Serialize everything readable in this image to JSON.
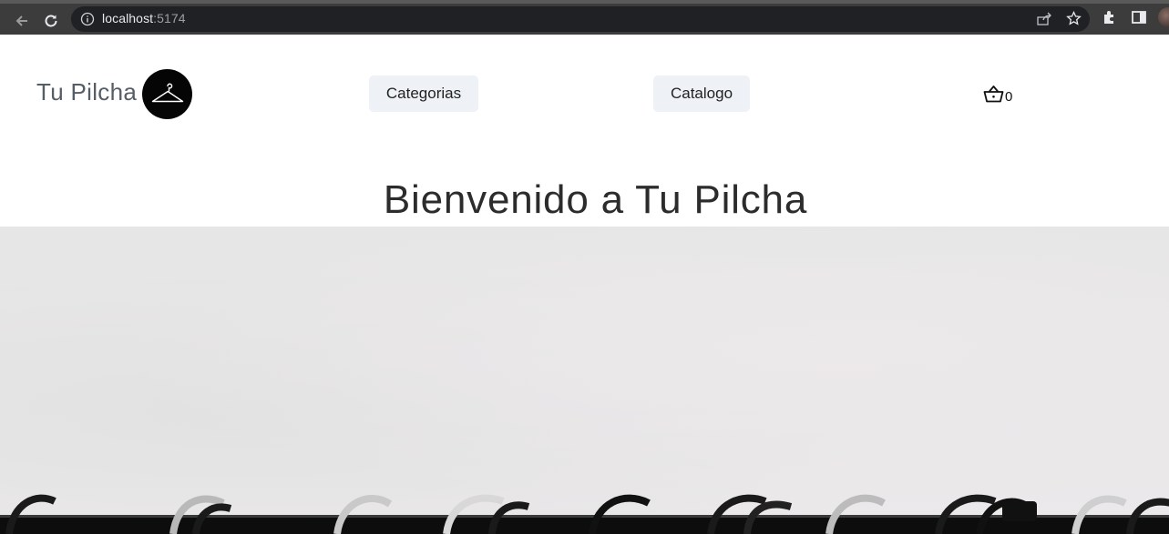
{
  "browser": {
    "url_host": "localhost",
    "url_port": ":5174",
    "icons": [
      "back-arrow-icon",
      "reload-icon",
      "info-icon",
      "share-icon",
      "star-icon",
      "extensions-icon",
      "sidepanel-icon",
      "profile-avatar"
    ]
  },
  "header": {
    "brand": "Tu Pilcha",
    "logo_icon": "hanger-icon",
    "nav": [
      {
        "label": "Categorias"
      },
      {
        "label": "Catalogo"
      }
    ],
    "cart": {
      "icon": "basket-icon",
      "count": "0"
    }
  },
  "hero": {
    "title": "Bienvenido a Tu Pilcha",
    "image": "clothes-rack-hangers"
  },
  "colors": {
    "nav_button_bg": "#eef2f6",
    "brand_text": "#555d66",
    "logo_bg": "#050505"
  }
}
